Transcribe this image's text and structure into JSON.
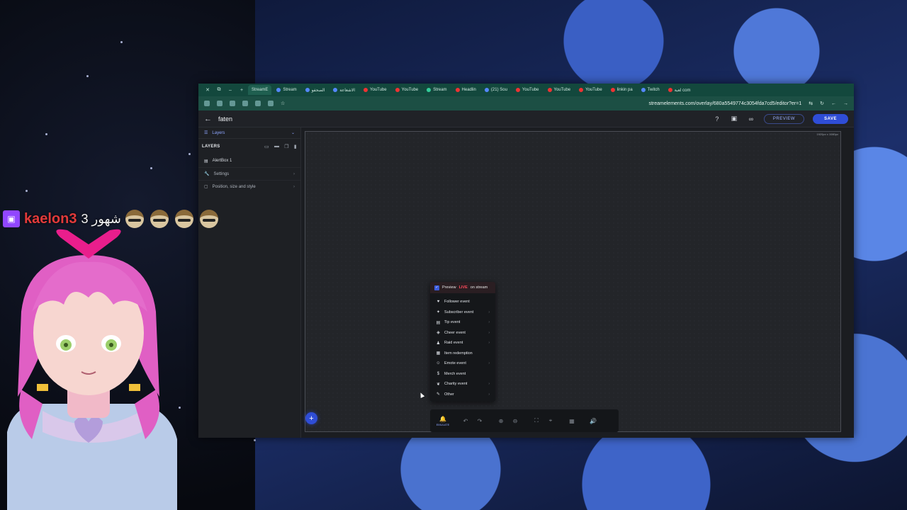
{
  "browser": {
    "tabs": [
      {
        "label": "StreamE",
        "active": true
      },
      {
        "label": "Stream"
      },
      {
        "label": "الصحفو"
      },
      {
        "label": "الاشعاعة"
      },
      {
        "label": "YouTube"
      },
      {
        "label": "YouTube"
      },
      {
        "label": "Stream"
      },
      {
        "label": "Headlin"
      },
      {
        "label": "(21) Sou"
      },
      {
        "label": "YouTube"
      },
      {
        "label": "YouTube"
      },
      {
        "label": "YouTube"
      },
      {
        "label": "linkin pa"
      },
      {
        "label": "Twitch"
      },
      {
        "label": "لعبة com"
      }
    ],
    "url": "streamelements.com/overlay/680a5549774c3054fda7cd5/editor?er=1"
  },
  "app": {
    "overlay_name": "faten",
    "preview_label": "PREVIEW",
    "save_label": "SAVE"
  },
  "sidebar": {
    "panel_title": "Layers",
    "layers_heading": "LAYERS",
    "layers": [
      {
        "label": "AlertBox 1"
      }
    ],
    "rows": [
      {
        "label": "Settings"
      },
      {
        "label": "Position, size and style"
      }
    ]
  },
  "canvas": {
    "size_label": "1920px x 1080px"
  },
  "emulate_menu": {
    "preview_prefix": "Preview",
    "preview_live": "LIVE",
    "preview_suffix": "on stream",
    "items": [
      {
        "label": "Follower event",
        "icon": "heart-icon"
      },
      {
        "label": "Subscriber event",
        "icon": "star-user-icon"
      },
      {
        "label": "Tip event",
        "icon": "money-icon"
      },
      {
        "label": "Cheer event",
        "icon": "bits-icon"
      },
      {
        "label": "Raid event",
        "icon": "group-icon"
      },
      {
        "label": "Item redemption",
        "icon": "gift-icon"
      },
      {
        "label": "Emote event",
        "icon": "emote-icon"
      },
      {
        "label": "Merch event",
        "icon": "dollar-icon"
      },
      {
        "label": "Charity event",
        "icon": "charity-icon"
      },
      {
        "label": "Other",
        "icon": "other-icon"
      }
    ]
  },
  "toolbar": {
    "emulate_label": "EMULATE"
  },
  "chat": {
    "username": "kaelon3",
    "message": "3 شهور"
  },
  "colors": {
    "accent": "#2f4dd6",
    "browser_frame": "#13483d",
    "twitch": "#9147ff",
    "chat_user": "#e23a3a"
  }
}
